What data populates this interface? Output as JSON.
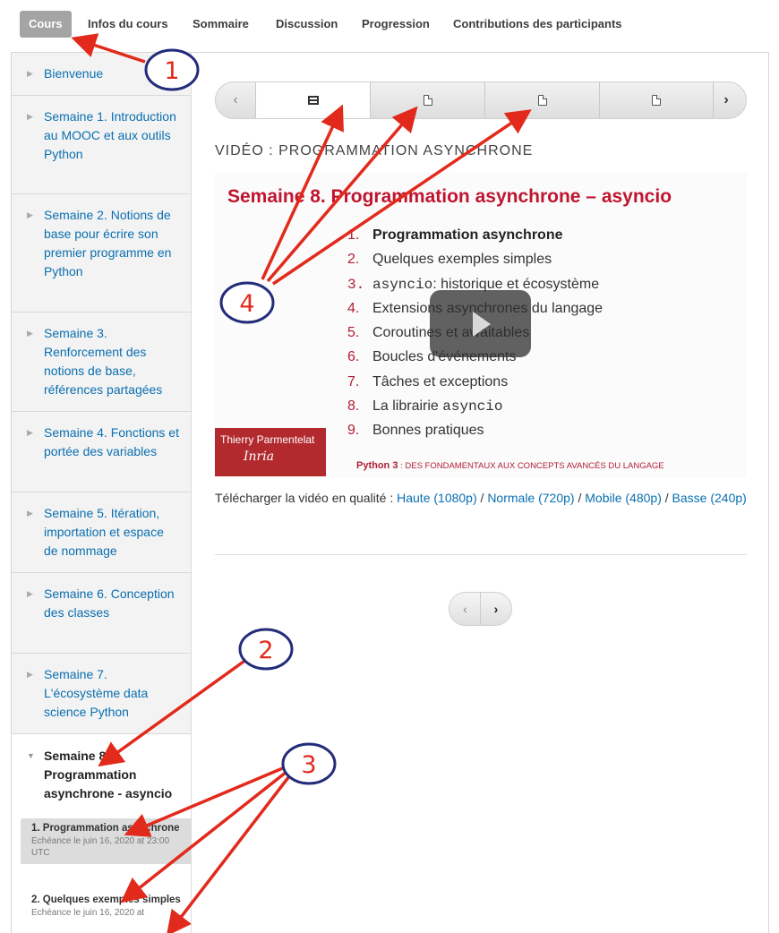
{
  "tabs": [
    "Cours",
    "Infos du cours",
    "Sommaire",
    "Discussion",
    "Progression",
    "Contributions des participants"
  ],
  "sidebar": {
    "chapters": [
      "Bienvenue",
      "Semaine 1. Introduction au MOOC et aux outils Python",
      "Semaine 2. Notions de base pour écrire son premier programme en Python",
      "Semaine 3. Renforcement des notions de base, références partagées",
      "Semaine 4. Fonctions et portée des variables",
      "Semaine 5. Itération, importation et espace de nommage",
      "Semaine 6. Conception des classes",
      "Semaine 7. L'écosystème data science Python"
    ],
    "open_chapter": "Semaine 8. Programmation asynchrone - asyncio",
    "sequences": [
      {
        "title": "1. Programmation asynchrone",
        "due": "Echéance le juin 16, 2020 at 23:00 UTC"
      },
      {
        "title": "2. Quelques exemples simples",
        "due": "Echéance le juin 16, 2020 at"
      }
    ]
  },
  "main": {
    "unit_title": "VIDÉO : PROGRAMMATION ASYNCHRONE",
    "video": {
      "slide_title": "Semaine 8. Programmation asynchrone – asyncio",
      "outline": [
        {
          "n": "1.",
          "text": "Programmation asynchrone"
        },
        {
          "n": "2.",
          "text": "Quelques exemples simples"
        },
        {
          "n": "3.",
          "code": "asyncio",
          "text": ": historique et écosystème"
        },
        {
          "n": "4.",
          "text": "Extensions asynchrones du langage"
        },
        {
          "n": "5.",
          "text": "Coroutines et awaitables"
        },
        {
          "n": "6.",
          "text": "Boucles d'événements"
        },
        {
          "n": "7.",
          "text": "Tâches et exceptions"
        },
        {
          "n": "8.",
          "text": "La librairie ",
          "code": "asyncio"
        },
        {
          "n": "9.",
          "text": "Bonnes pratiques"
        }
      ],
      "speaker": "Thierry Parmentelat",
      "logo": "Inria",
      "footer_lead": "Python 3",
      "footer_rest": " : DES FONDAMENTAUX AUX CONCEPTS AVANCÉS DU LANGAGE"
    },
    "downloads": {
      "label": "Télécharger la vidéo en qualité : ",
      "haute": "Haute (1080p)",
      "normale": "Normale (720p)",
      "mobile": "Mobile (480p)",
      "basse": "Basse (240p)",
      "sep": " / "
    },
    "nav": {
      "prev": "‹",
      "next": "›"
    }
  },
  "annotations": [
    "1",
    "2",
    "3",
    "4"
  ],
  "colors": {
    "link": "#0a6fb0",
    "slide_red": "#c0152f",
    "arrow": "#e22a1c",
    "circle": "#232c7a"
  }
}
